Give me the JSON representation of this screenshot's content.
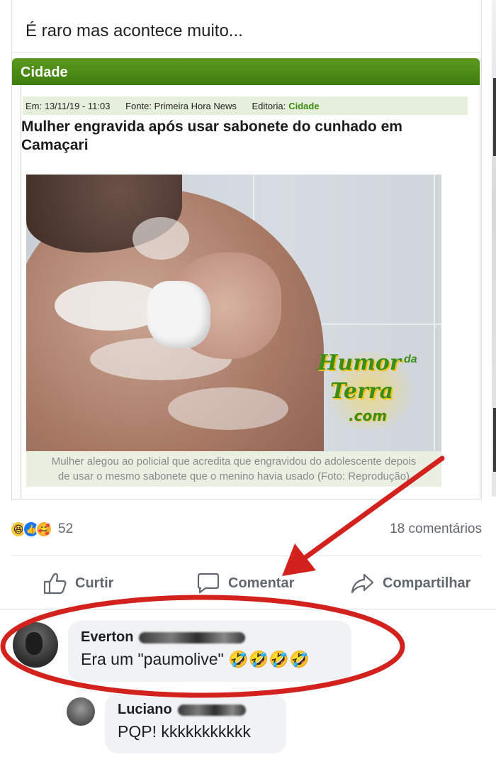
{
  "post": {
    "text": "É raro mas acontece muito..."
  },
  "news": {
    "section": "Cidade",
    "date_label": "Em: 13/11/19 - 11:03",
    "source_label": "Fonte: Primeira Hora News",
    "editoria_label": "Editoria:",
    "editoria_value": "Cidade",
    "headline": "Mulher engravida após usar sabonete do cunhado em Camaçari",
    "caption_line1": "Mulher alegou ao policial que acredita que engravidou do adolescente depois",
    "caption_line2": "de usar o mesmo sabonete que o menino havia usado (Foto: Reprodução)",
    "watermark": {
      "humor": "Humor",
      "da": "da",
      "terra": "Terra",
      "dotcom": ".com"
    }
  },
  "stats": {
    "reaction_icons": [
      "haha-icon",
      "like-icon",
      "care-icon"
    ],
    "reaction_count": "52",
    "comments_count": "18 comentários"
  },
  "actions": {
    "like": "Curtir",
    "comment": "Comentar",
    "share": "Compartilhar"
  },
  "comments": [
    {
      "name": "Everton",
      "text": "Era um \"paumolive\" 🤣🤣🤣🤣"
    },
    {
      "name": "Luciano",
      "text": "PQP! kkkkkkkkkkk"
    }
  ],
  "colors": {
    "news_header": "#4a8a14",
    "annotation_red": "#d3221d",
    "meta_bar": "#e6efdc",
    "action_gray": "#606770"
  }
}
